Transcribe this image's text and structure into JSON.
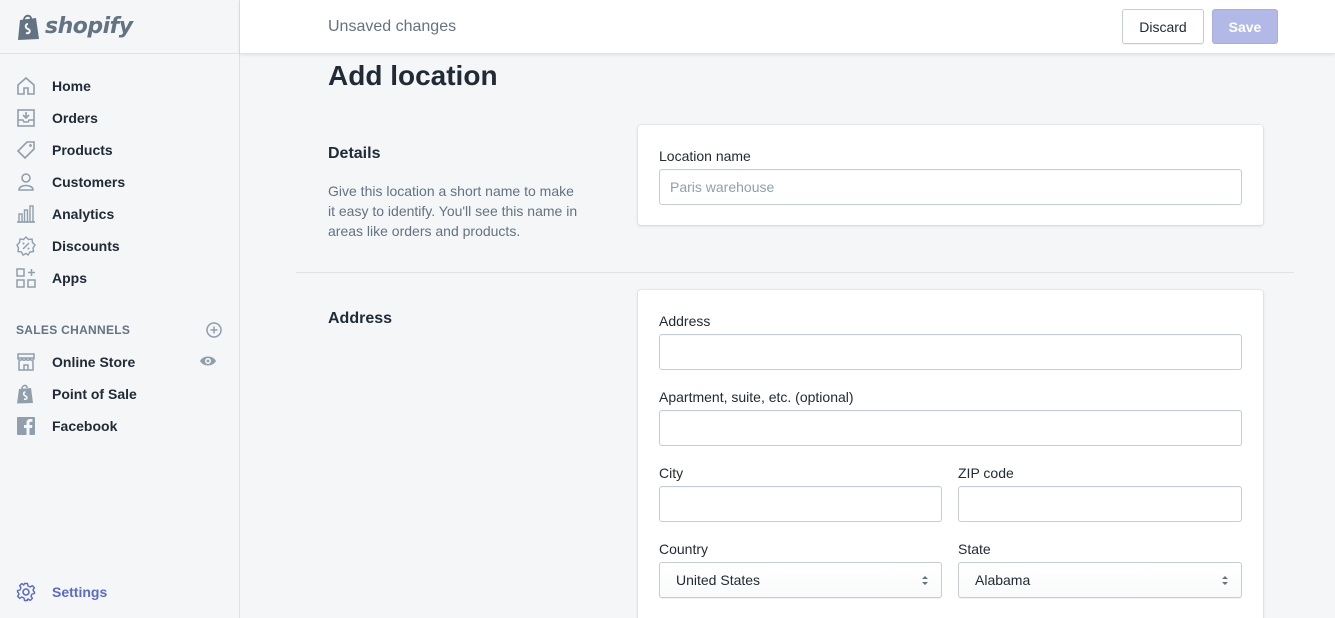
{
  "brand": {
    "name": "shopify",
    "accent": "#5c6ac4"
  },
  "sidebar": {
    "items": [
      {
        "label": "Home",
        "icon": "home-icon"
      },
      {
        "label": "Orders",
        "icon": "orders-icon"
      },
      {
        "label": "Products",
        "icon": "tag-icon"
      },
      {
        "label": "Customers",
        "icon": "person-icon"
      },
      {
        "label": "Analytics",
        "icon": "bar-chart-icon"
      },
      {
        "label": "Discounts",
        "icon": "discount-icon"
      },
      {
        "label": "Apps",
        "icon": "apps-icon"
      }
    ],
    "sales_channels_title": "SALES CHANNELS",
    "channels": [
      {
        "label": "Online Store",
        "icon": "store-icon"
      },
      {
        "label": "Point of Sale",
        "icon": "shopify-bag-icon"
      },
      {
        "label": "Facebook",
        "icon": "facebook-icon"
      }
    ],
    "settings_label": "Settings"
  },
  "topbar": {
    "status": "Unsaved changes",
    "discard_label": "Discard",
    "save_label": "Save"
  },
  "page": {
    "title": "Add location",
    "details": {
      "title": "Details",
      "description": "Give this location a short name to make it easy to identify. You'll see this name in areas like orders and products.",
      "location_name_label": "Location name",
      "location_name_placeholder": "Paris warehouse"
    },
    "address": {
      "title": "Address",
      "address_label": "Address",
      "apartment_label": "Apartment, suite, etc. (optional)",
      "city_label": "City",
      "zip_label": "ZIP code",
      "country_label": "Country",
      "country_value": "United States",
      "state_label": "State",
      "state_value": "Alabama"
    }
  }
}
